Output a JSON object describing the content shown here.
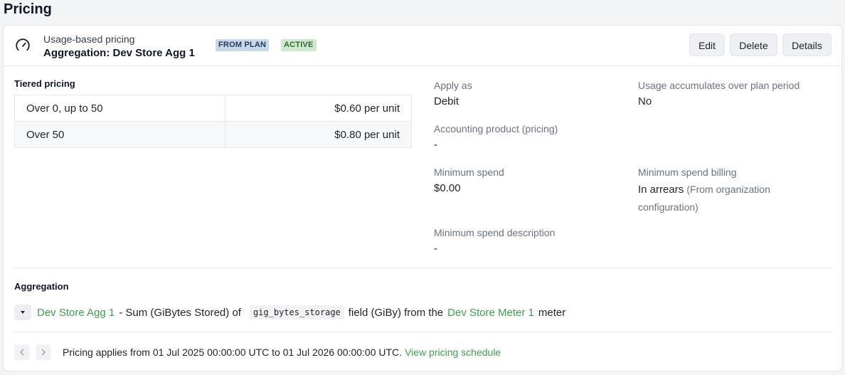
{
  "page": {
    "title": "Pricing"
  },
  "header": {
    "subtitle": "Usage-based pricing",
    "title": "Aggregation: Dev Store Agg 1",
    "badges": {
      "plan": "FROM PLAN",
      "active": "ACTIVE"
    },
    "icon": "gauge-icon"
  },
  "actions": {
    "edit": "Edit",
    "delete": "Delete",
    "details": "Details"
  },
  "tiered_pricing": {
    "label": "Tiered pricing",
    "rows": [
      {
        "range": "Over 0, up to 50",
        "price": "$0.60 per unit"
      },
      {
        "range": "Over 50",
        "price": "$0.80 per unit"
      }
    ]
  },
  "details": {
    "apply_as": {
      "label": "Apply as",
      "value": "Debit"
    },
    "usage_accumulates": {
      "label": "Usage accumulates over plan period",
      "value": "No"
    },
    "accounting_product": {
      "label": "Accounting product (pricing)",
      "value": "-"
    },
    "minimum_spend": {
      "label": "Minimum spend",
      "value": "$0.00"
    },
    "minimum_spend_billing": {
      "label": "Minimum spend billing",
      "value": "In arrears",
      "note": "(From organization configuration)"
    },
    "minimum_spend_description": {
      "label": "Minimum spend description",
      "value": "-"
    }
  },
  "aggregation": {
    "label": "Aggregation",
    "name_link": "Dev Store Agg 1",
    "text_1": "- Sum (GiBytes Stored) of",
    "field_code": "gig_bytes_storage",
    "text_2": "field (GiBy) from the",
    "meter_link": "Dev Store Meter 1",
    "text_3": "meter"
  },
  "footer": {
    "text": "Pricing applies from 01 Jul 2025 00:00:00 UTC to 01 Jul 2026 00:00:00 UTC.",
    "link": "View pricing schedule"
  },
  "colors": {
    "link": "#3aa34a",
    "badge_plan_bg": "#c7d7ea",
    "badge_active_bg": "#cfe9cf"
  }
}
